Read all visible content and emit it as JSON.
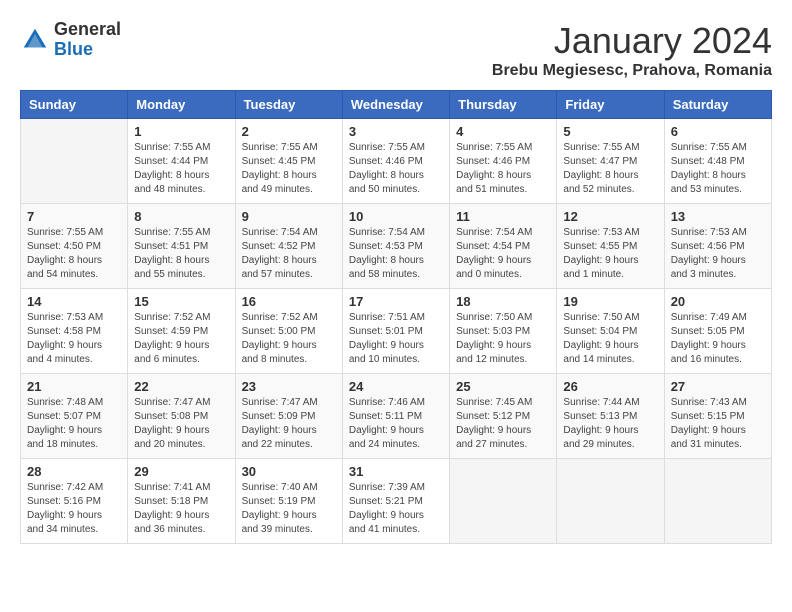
{
  "header": {
    "logo": {
      "general": "General",
      "blue": "Blue"
    },
    "title": "January 2024",
    "subtitle": "Brebu Megiesesc, Prahova, Romania"
  },
  "calendar": {
    "headers": [
      "Sunday",
      "Monday",
      "Tuesday",
      "Wednesday",
      "Thursday",
      "Friday",
      "Saturday"
    ],
    "weeks": [
      [
        {
          "day": "",
          "sunrise": "",
          "sunset": "",
          "daylight": ""
        },
        {
          "day": "1",
          "sunrise": "Sunrise: 7:55 AM",
          "sunset": "Sunset: 4:44 PM",
          "daylight": "Daylight: 8 hours and 48 minutes."
        },
        {
          "day": "2",
          "sunrise": "Sunrise: 7:55 AM",
          "sunset": "Sunset: 4:45 PM",
          "daylight": "Daylight: 8 hours and 49 minutes."
        },
        {
          "day": "3",
          "sunrise": "Sunrise: 7:55 AM",
          "sunset": "Sunset: 4:46 PM",
          "daylight": "Daylight: 8 hours and 50 minutes."
        },
        {
          "day": "4",
          "sunrise": "Sunrise: 7:55 AM",
          "sunset": "Sunset: 4:46 PM",
          "daylight": "Daylight: 8 hours and 51 minutes."
        },
        {
          "day": "5",
          "sunrise": "Sunrise: 7:55 AM",
          "sunset": "Sunset: 4:47 PM",
          "daylight": "Daylight: 8 hours and 52 minutes."
        },
        {
          "day": "6",
          "sunrise": "Sunrise: 7:55 AM",
          "sunset": "Sunset: 4:48 PM",
          "daylight": "Daylight: 8 hours and 53 minutes."
        }
      ],
      [
        {
          "day": "7",
          "sunrise": "Sunrise: 7:55 AM",
          "sunset": "Sunset: 4:50 PM",
          "daylight": "Daylight: 8 hours and 54 minutes."
        },
        {
          "day": "8",
          "sunrise": "Sunrise: 7:55 AM",
          "sunset": "Sunset: 4:51 PM",
          "daylight": "Daylight: 8 hours and 55 minutes."
        },
        {
          "day": "9",
          "sunrise": "Sunrise: 7:54 AM",
          "sunset": "Sunset: 4:52 PM",
          "daylight": "Daylight: 8 hours and 57 minutes."
        },
        {
          "day": "10",
          "sunrise": "Sunrise: 7:54 AM",
          "sunset": "Sunset: 4:53 PM",
          "daylight": "Daylight: 8 hours and 58 minutes."
        },
        {
          "day": "11",
          "sunrise": "Sunrise: 7:54 AM",
          "sunset": "Sunset: 4:54 PM",
          "daylight": "Daylight: 9 hours and 0 minutes."
        },
        {
          "day": "12",
          "sunrise": "Sunrise: 7:53 AM",
          "sunset": "Sunset: 4:55 PM",
          "daylight": "Daylight: 9 hours and 1 minute."
        },
        {
          "day": "13",
          "sunrise": "Sunrise: 7:53 AM",
          "sunset": "Sunset: 4:56 PM",
          "daylight": "Daylight: 9 hours and 3 minutes."
        }
      ],
      [
        {
          "day": "14",
          "sunrise": "Sunrise: 7:53 AM",
          "sunset": "Sunset: 4:58 PM",
          "daylight": "Daylight: 9 hours and 4 minutes."
        },
        {
          "day": "15",
          "sunrise": "Sunrise: 7:52 AM",
          "sunset": "Sunset: 4:59 PM",
          "daylight": "Daylight: 9 hours and 6 minutes."
        },
        {
          "day": "16",
          "sunrise": "Sunrise: 7:52 AM",
          "sunset": "Sunset: 5:00 PM",
          "daylight": "Daylight: 9 hours and 8 minutes."
        },
        {
          "day": "17",
          "sunrise": "Sunrise: 7:51 AM",
          "sunset": "Sunset: 5:01 PM",
          "daylight": "Daylight: 9 hours and 10 minutes."
        },
        {
          "day": "18",
          "sunrise": "Sunrise: 7:50 AM",
          "sunset": "Sunset: 5:03 PM",
          "daylight": "Daylight: 9 hours and 12 minutes."
        },
        {
          "day": "19",
          "sunrise": "Sunrise: 7:50 AM",
          "sunset": "Sunset: 5:04 PM",
          "daylight": "Daylight: 9 hours and 14 minutes."
        },
        {
          "day": "20",
          "sunrise": "Sunrise: 7:49 AM",
          "sunset": "Sunset: 5:05 PM",
          "daylight": "Daylight: 9 hours and 16 minutes."
        }
      ],
      [
        {
          "day": "21",
          "sunrise": "Sunrise: 7:48 AM",
          "sunset": "Sunset: 5:07 PM",
          "daylight": "Daylight: 9 hours and 18 minutes."
        },
        {
          "day": "22",
          "sunrise": "Sunrise: 7:47 AM",
          "sunset": "Sunset: 5:08 PM",
          "daylight": "Daylight: 9 hours and 20 minutes."
        },
        {
          "day": "23",
          "sunrise": "Sunrise: 7:47 AM",
          "sunset": "Sunset: 5:09 PM",
          "daylight": "Daylight: 9 hours and 22 minutes."
        },
        {
          "day": "24",
          "sunrise": "Sunrise: 7:46 AM",
          "sunset": "Sunset: 5:11 PM",
          "daylight": "Daylight: 9 hours and 24 minutes."
        },
        {
          "day": "25",
          "sunrise": "Sunrise: 7:45 AM",
          "sunset": "Sunset: 5:12 PM",
          "daylight": "Daylight: 9 hours and 27 minutes."
        },
        {
          "day": "26",
          "sunrise": "Sunrise: 7:44 AM",
          "sunset": "Sunset: 5:13 PM",
          "daylight": "Daylight: 9 hours and 29 minutes."
        },
        {
          "day": "27",
          "sunrise": "Sunrise: 7:43 AM",
          "sunset": "Sunset: 5:15 PM",
          "daylight": "Daylight: 9 hours and 31 minutes."
        }
      ],
      [
        {
          "day": "28",
          "sunrise": "Sunrise: 7:42 AM",
          "sunset": "Sunset: 5:16 PM",
          "daylight": "Daylight: 9 hours and 34 minutes."
        },
        {
          "day": "29",
          "sunrise": "Sunrise: 7:41 AM",
          "sunset": "Sunset: 5:18 PM",
          "daylight": "Daylight: 9 hours and 36 minutes."
        },
        {
          "day": "30",
          "sunrise": "Sunrise: 7:40 AM",
          "sunset": "Sunset: 5:19 PM",
          "daylight": "Daylight: 9 hours and 39 minutes."
        },
        {
          "day": "31",
          "sunrise": "Sunrise: 7:39 AM",
          "sunset": "Sunset: 5:21 PM",
          "daylight": "Daylight: 9 hours and 41 minutes."
        },
        {
          "day": "",
          "sunrise": "",
          "sunset": "",
          "daylight": ""
        },
        {
          "day": "",
          "sunrise": "",
          "sunset": "",
          "daylight": ""
        },
        {
          "day": "",
          "sunrise": "",
          "sunset": "",
          "daylight": ""
        }
      ]
    ]
  }
}
